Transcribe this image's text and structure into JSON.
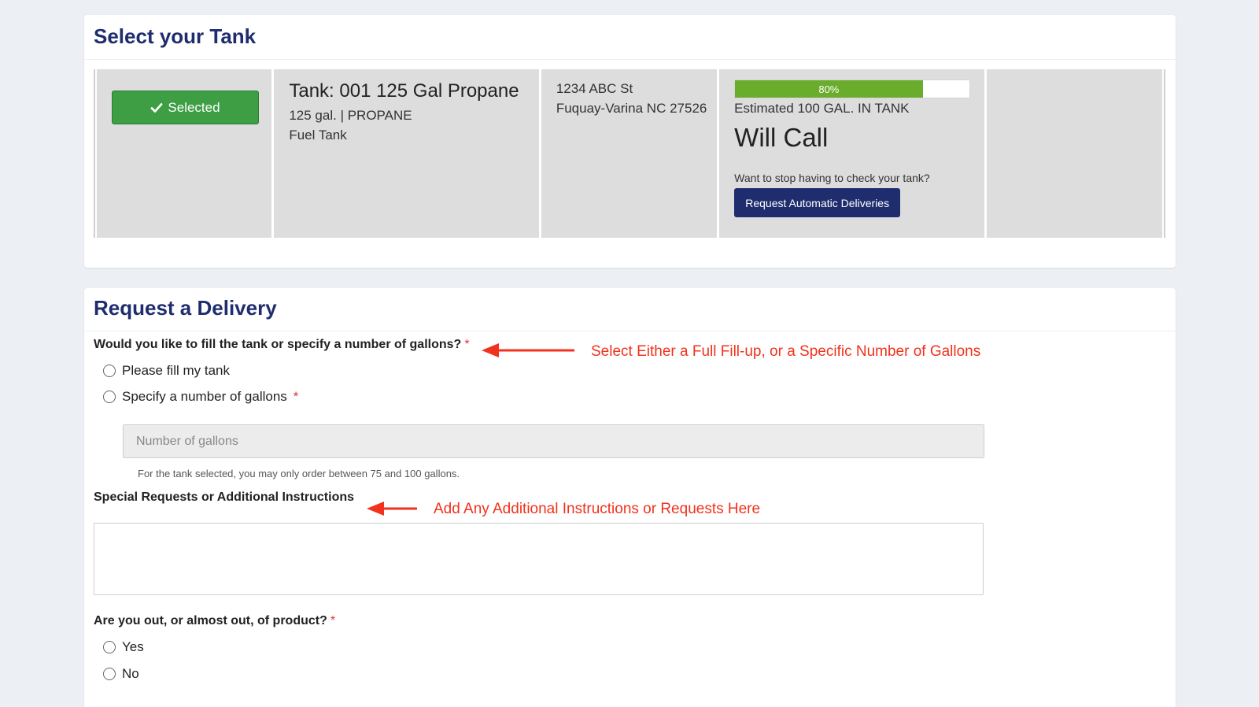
{
  "tank_section": {
    "title": "Select your Tank",
    "selected_label": "Selected",
    "tank_name": "Tank: 001 125 Gal Propane",
    "tank_spec": "125 gal. | PROPANE",
    "tank_type": "Fuel Tank",
    "address_line1": "1234 ABC St",
    "address_line2": "Fuquay-Varina NC 27526",
    "level_percent": 80,
    "level_label": "80%",
    "estimated": "Estimated 100 GAL. IN TANK",
    "plan": "Will Call",
    "stop_checking_text": "Want to stop having to check your tank?",
    "auto_delivery_label": "Request Automatic Deliveries"
  },
  "delivery_section": {
    "title": "Request a Delivery",
    "fill_question": "Would you like to fill the tank or specify a number of gallons?",
    "required_mark": "*",
    "option_fill": "Please fill my tank",
    "option_specify": "Specify a number of gallons",
    "gallons_placeholder": "Number of gallons",
    "gallons_help": "For the tank selected, you may only order between 75 and 100 gallons.",
    "instructions_label": "Special Requests or Additional Instructions",
    "instructions_value": "",
    "out_question": "Are you out, or almost out, of product?",
    "option_yes": "Yes",
    "option_no": "No"
  },
  "annotations": {
    "fill_note": "Select Either a Full Fill-up, or a Specific Number of Gallons",
    "instructions_note": "Add Any Additional Instructions or Requests Here",
    "color": "#f1321c"
  },
  "colors": {
    "brand_navy": "#1f2d6e",
    "selected_green": "#3d9e43",
    "progress_green": "#6aad2c",
    "required_red": "#d9363e"
  }
}
